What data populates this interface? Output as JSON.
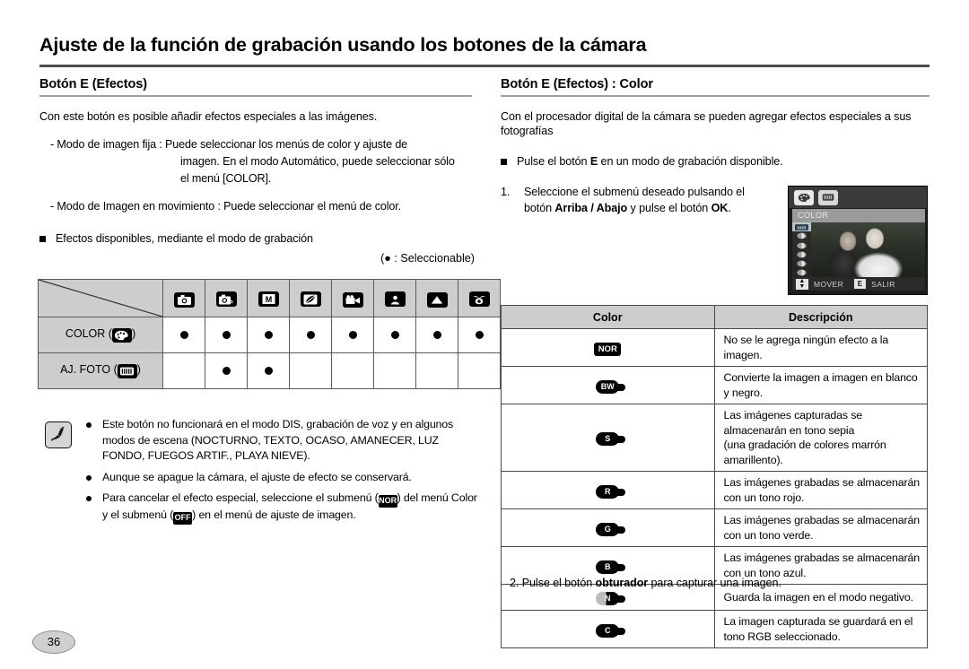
{
  "page": {
    "title": "Ajuste de la función de grabación usando los botones de la cámara",
    "number": "36"
  },
  "left": {
    "heading": "Botón E (Efectos)",
    "intro": "Con este botón es posible añadir efectos especiales a las imágenes.",
    "dash_items": [
      "- Modo de imagen fija : Puede seleccionar los menús de color y ajuste de",
      "imagen. En el modo Automático, puede seleccionar sólo",
      "el menú [COLOR].",
      "- Modo de Imagen en movimiento : Puede seleccionar el menú de color."
    ],
    "available_effects_heading": "Efectos disponibles, mediante el modo de grabación",
    "selectable_legend": "(● : Seleccionable)",
    "mode_table": {
      "mode_icons": [
        "auto-camera-icon",
        "program-camera-icon",
        "manual-m-icon",
        "dis-icon",
        "movie-camera-icon",
        "portrait-icon",
        "landscape-icon",
        "macro-flower-icon"
      ],
      "rows": [
        {
          "label": "COLOR (",
          "label_suffix": ")",
          "icon": "color-palette-icon",
          "marks": [
            true,
            true,
            true,
            true,
            true,
            true,
            true,
            true
          ]
        },
        {
          "label": "AJ. FOTO (",
          "label_suffix": ")",
          "icon": "image-adjust-icon",
          "marks": [
            false,
            true,
            true,
            false,
            false,
            false,
            false,
            false
          ]
        }
      ]
    },
    "notes": [
      "Este botón no funcionará en el modo DIS, grabación de voz y en algunos modos de escena (NOCTURNO, TEXTO, OCASO, AMANECER, LUZ FONDO, FUEGOS ARTIF., PLAYA NIEVE).",
      "Aunque se apague la cámara, el ajuste de efecto se conservará.",
      "Para cancelar el efecto especial, seleccione el submenú ( ) del menú Color y el submenú ( ) en el menú de ajuste de imagen."
    ],
    "note3_parts": {
      "a": "Para cancelar el efecto especial, seleccione el submenú (",
      "badge1": "NOR",
      "b": ") del menú Color y el submenú (",
      "badge2": "OFF",
      "c": ") en el menú de ajuste de imagen."
    }
  },
  "right": {
    "heading": "Botón E (Efectos) : Color",
    "intro": "Con el procesador digital de la cámara se pueden agregar efectos especiales a sus fotografías",
    "bullet": "Pulse el botón E en un modo de grabación disponible.",
    "bullet_parts": {
      "a": "Pulse el botón ",
      "b": "E",
      "c": " en un modo de grabación disponible."
    },
    "step1": {
      "num": "1.",
      "line1": "Seleccione el submenú deseado pulsando el",
      "line2_a": "botón ",
      "line2_b": "Arriba / Abajo",
      "line2_c": " y pulse el botón ",
      "line2_d": "OK",
      "line2_e": "."
    },
    "step2": {
      "num": "2.",
      "a": "Pulse el botón ",
      "b": "obturador",
      "c": " para capturar una imagen."
    },
    "lcd": {
      "tab1_icon": "color-palette-icon",
      "tab2_icon": "image-adjust-icon",
      "menu_title": "COLOR",
      "options": [
        "NOR",
        "BW",
        "S",
        "R",
        "G",
        "B",
        "N"
      ],
      "selected_index": 0,
      "bottom_move": "MOVER",
      "bottom_exit_key": "E",
      "bottom_exit": "SALIR"
    },
    "color_table": {
      "headers": [
        "Color",
        "Descripción"
      ],
      "rows": [
        {
          "icon": "NOR",
          "icon_style": "rect",
          "desc": "No se le agrega ningún efecto a la imagen."
        },
        {
          "icon": "BW",
          "icon_style": "pill",
          "desc": "Convierte la imagen a imagen en blanco y negro."
        },
        {
          "icon": "S",
          "icon_style": "pill",
          "desc": "Las imágenes capturadas se almacenarán en tono sepia (una gradación de colores marrón amarillento).",
          "tall": true
        },
        {
          "icon": "R",
          "icon_style": "pill",
          "desc": "Las imágenes grabadas se almacenarán con un tono rojo."
        },
        {
          "icon": "G",
          "icon_style": "pill",
          "desc": "Las imágenes grabadas se almacenarán con un tono verde."
        },
        {
          "icon": "B",
          "icon_style": "pill",
          "desc": "Las imágenes grabadas se almacenarán con un tono azul."
        },
        {
          "icon": "N",
          "icon_style": "half",
          "desc": "Guarda la imagen en el modo negativo."
        },
        {
          "icon": "C",
          "icon_style": "pill",
          "desc": "La imagen capturada se guardará en el tono RGB seleccionado."
        }
      ],
      "row3_line1": "Las imágenes capturadas se almacenarán en tono sepia",
      "row3_line2": "(una gradación de colores marrón amarillento)."
    }
  },
  "colors": {
    "header_rule": "#4d4d4d",
    "section_rule": "#a0a0a0",
    "table_header_bg": "#cdcdcd",
    "table_border": "#4a4a4a",
    "page_badge_bg": "#d0d0d0"
  }
}
